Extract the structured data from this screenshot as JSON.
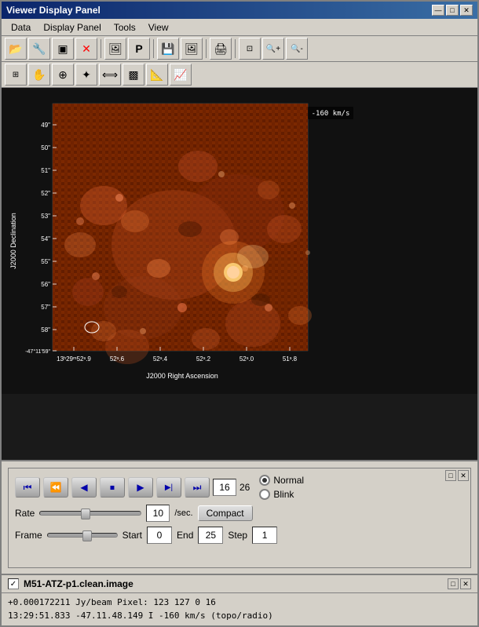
{
  "window": {
    "title": "Viewer  Display  Panel",
    "min_btn": "—",
    "max_btn": "□",
    "close_btn": "✕"
  },
  "menu": {
    "items": [
      "Data",
      "Display Panel",
      "Tools",
      "View"
    ]
  },
  "toolbar1": {
    "buttons": [
      {
        "name": "open",
        "icon": "📂"
      },
      {
        "name": "settings",
        "icon": "🔧"
      },
      {
        "name": "panel",
        "icon": "▣"
      },
      {
        "name": "close",
        "icon": "✕"
      },
      {
        "name": "image",
        "icon": "🖼"
      },
      {
        "name": "marker",
        "icon": "P"
      },
      {
        "name": "save",
        "icon": "💾"
      },
      {
        "name": "export",
        "icon": "📷"
      },
      {
        "name": "print",
        "icon": "🖨"
      },
      {
        "name": "zoom-fit",
        "icon": "⊡"
      },
      {
        "name": "zoom-in",
        "icon": "+🔍"
      },
      {
        "name": "zoom-out",
        "icon": "-🔍"
      }
    ]
  },
  "toolbar2": {
    "buttons": [
      {
        "name": "zoom-rect",
        "icon": "⊞"
      },
      {
        "name": "pan",
        "icon": "✋"
      },
      {
        "name": "crosshair",
        "icon": "⊕"
      },
      {
        "name": "position",
        "icon": "✦"
      },
      {
        "name": "adjust",
        "icon": "⟺"
      },
      {
        "name": "region",
        "icon": "▩"
      },
      {
        "name": "measure",
        "icon": "📐"
      },
      {
        "name": "profile",
        "icon": "📈"
      }
    ]
  },
  "image": {
    "velocity": "-160 km/s",
    "y_axis_label": "J2000 Declination",
    "x_axis_label": "J2000 Right Ascension",
    "yticks": [
      "49\"",
      "50\"",
      "51\"",
      "52\"",
      "53\"",
      "54\"",
      "55\"",
      "56\"",
      "57\"",
      "58\"",
      "-47°11'59\""
    ],
    "xticks": [
      "13ʰ29ᵐ52ˢ.9",
      "52ˢ.6",
      "52ˢ.4",
      "52ˢ.2",
      "52ˢ.0",
      "51ˢ.8"
    ],
    "bottom_label": "-47°11'59\""
  },
  "animation": {
    "corner_buttons": [
      "□",
      "✕"
    ],
    "playback_buttons": [
      {
        "name": "skip-to-start",
        "icon": "⏮"
      },
      {
        "name": "step-back-fast",
        "icon": "⏪"
      },
      {
        "name": "step-back",
        "icon": "◀"
      },
      {
        "name": "stop",
        "icon": "⏹"
      },
      {
        "name": "play",
        "icon": "▶"
      },
      {
        "name": "step-forward",
        "icon": "▶|"
      },
      {
        "name": "skip-to-end",
        "icon": "⏭"
      }
    ],
    "frame_current": "16",
    "frame_total": "26",
    "mode_normal": "Normal",
    "mode_blink": "Blink",
    "rate_label": "Rate",
    "rate_value": "10",
    "rate_unit": "/sec.",
    "compact_btn": "Compact",
    "frame_label": "Frame",
    "start_label": "Start",
    "start_value": "0",
    "end_label": "End",
    "end_value": "25",
    "step_label": "Step",
    "step_value": "1"
  },
  "status": {
    "corner_buttons": [
      "□",
      "✕"
    ],
    "checkbox_checked": "✓",
    "filename": "M51-ATZ-p1.clean.image",
    "line1": "+0.000172211  Jy/beam   Pixel: 123 127 0 16",
    "line2": "13:29:51.833   -47.11.48.149   I   -160 km/s (topo/radio)"
  }
}
